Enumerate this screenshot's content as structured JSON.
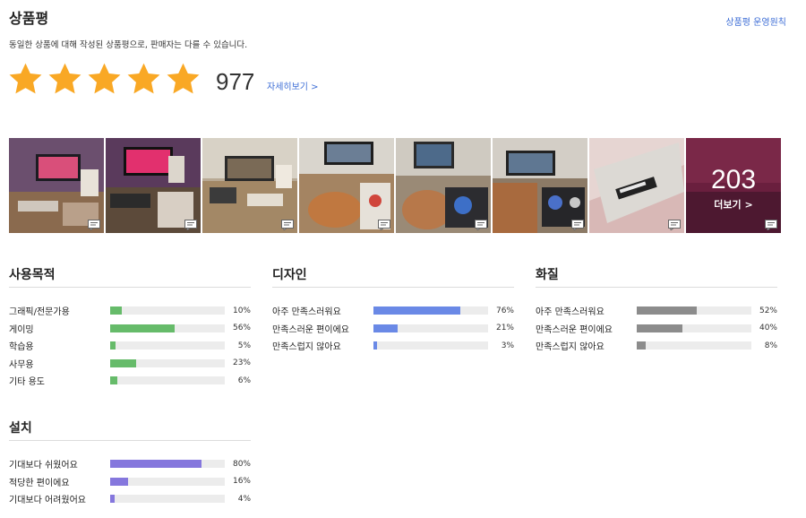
{
  "header": {
    "title": "상품평",
    "policy_link": "상품평 운영원칙",
    "notice": "동일한 상품에 대해 작성된 상품평으로, 판매자는 다를 수 있습니다."
  },
  "rating": {
    "stars": 5,
    "max_stars": 5,
    "star_color": "#f9a825",
    "review_count": "977",
    "detail_link": "자세히보기 >"
  },
  "photos": {
    "thumbnail_count": 8,
    "more_count": "203",
    "more_label": "더보기 >",
    "comment_icon": "comment-icon"
  },
  "sections": {
    "usage": {
      "title": "사용목적",
      "color": "#66bb6a",
      "items": [
        {
          "label": "그래픽/전문가용",
          "percent": "10%",
          "value": 10
        },
        {
          "label": "게이밍",
          "percent": "56%",
          "value": 56
        },
        {
          "label": "학습용",
          "percent": "5%",
          "value": 5
        },
        {
          "label": "사무용",
          "percent": "23%",
          "value": 23
        },
        {
          "label": "기타 용도",
          "percent": "6%",
          "value": 6
        }
      ]
    },
    "design": {
      "title": "디자인",
      "color": "#6a89e6",
      "items": [
        {
          "label": "아주 만족스러워요",
          "percent": "76%",
          "value": 76
        },
        {
          "label": "만족스러운 편이에요",
          "percent": "21%",
          "value": 21
        },
        {
          "label": "만족스럽지 않아요",
          "percent": "3%",
          "value": 3
        }
      ]
    },
    "quality": {
      "title": "화질",
      "color": "#8c8c8c",
      "items": [
        {
          "label": "아주 만족스러워요",
          "percent": "52%",
          "value": 52
        },
        {
          "label": "만족스러운 편이에요",
          "percent": "40%",
          "value": 40
        },
        {
          "label": "만족스럽지 않아요",
          "percent": "8%",
          "value": 8
        }
      ]
    },
    "install": {
      "title": "설치",
      "color": "#8577dd",
      "items": [
        {
          "label": "기대보다 쉬웠어요",
          "percent": "80%",
          "value": 80
        },
        {
          "label": "적당한 편이에요",
          "percent": "16%",
          "value": 16
        },
        {
          "label": "기대보다 어려웠어요",
          "percent": "4%",
          "value": 4
        }
      ]
    }
  }
}
